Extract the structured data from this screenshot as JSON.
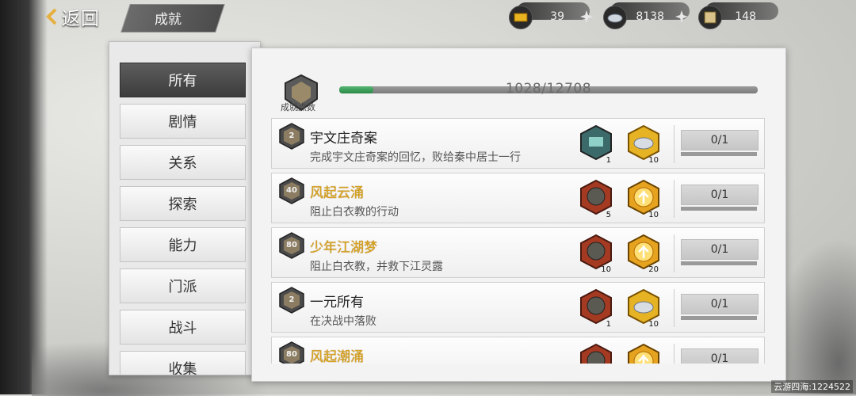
{
  "header": {
    "back_label": "返回",
    "page_tab": "成就"
  },
  "currencies": [
    {
      "icon": "gold-ingot-icon",
      "value": "39"
    },
    {
      "icon": "silver-ingot-icon",
      "value": "8138"
    },
    {
      "icon": "scroll-icon",
      "value": "148"
    }
  ],
  "sidebar": {
    "items": [
      {
        "label": "所有",
        "active": true
      },
      {
        "label": "剧情"
      },
      {
        "label": "关系"
      },
      {
        "label": "探索"
      },
      {
        "label": "能力"
      },
      {
        "label": "门派"
      },
      {
        "label": "战斗"
      },
      {
        "label": "收集"
      }
    ]
  },
  "points": {
    "label": "成就点数",
    "progress_text": "1028/12708",
    "current": 1028,
    "total": 12708
  },
  "achievements": [
    {
      "badge": "2",
      "title": "宇文庄奇案",
      "gold": false,
      "desc": "完成宇文庄奇案的回忆，败给秦中居士一行",
      "rewards": [
        {
          "icon": "token-icon",
          "count": "1"
        },
        {
          "icon": "silver-ingot-icon",
          "count": "10"
        }
      ],
      "progress": "0/1"
    },
    {
      "badge": "40",
      "title": "风起云涌",
      "gold": true,
      "desc": "阻止白衣教的行动",
      "rewards": [
        {
          "icon": "supply-bag-icon",
          "count": "5"
        },
        {
          "icon": "flame-orb-icon",
          "count": "10"
        }
      ],
      "progress": "0/1"
    },
    {
      "badge": "80",
      "title": "少年江湖梦",
      "gold": true,
      "desc": "阻止白衣教，并救下江灵露",
      "rewards": [
        {
          "icon": "supply-bag-icon",
          "count": "10"
        },
        {
          "icon": "flame-orb-icon",
          "count": "20"
        }
      ],
      "progress": "0/1"
    },
    {
      "badge": "2",
      "title": "一元所有",
      "gold": false,
      "desc": "在决战中落败",
      "rewards": [
        {
          "icon": "supply-bag-icon",
          "count": "1"
        },
        {
          "icon": "silver-ingot-icon",
          "count": "10"
        }
      ],
      "progress": "0/1"
    },
    {
      "badge": "80",
      "title": "风起潮涌",
      "gold": true,
      "desc": "",
      "rewards": [
        {
          "icon": "supply-bag-icon",
          "count": ""
        },
        {
          "icon": "flame-orb-icon",
          "count": ""
        }
      ],
      "progress": "0/1"
    }
  ],
  "watermark": "云游四海:1224522"
}
